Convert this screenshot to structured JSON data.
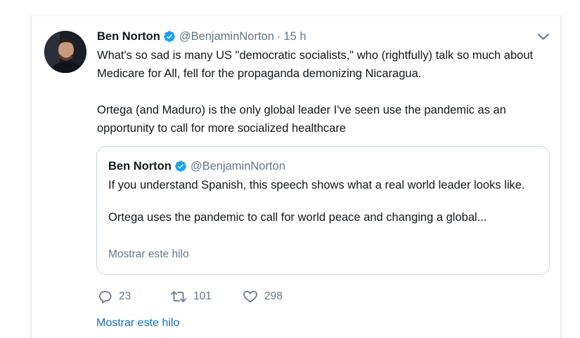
{
  "tweet": {
    "author_name": "Ben Norton",
    "handle": "@BenjaminNorton",
    "separator": "·",
    "time": "15 h",
    "paragraph_1": "What's so sad is many US \"democratic socialists,\" who (rightfully) talk so much about Medicare for All, fell for the propaganda demonizing Nicaragua.",
    "paragraph_2": "Ortega (and Maduro) is the only global leader I've seen use the pandemic as an opportunity to call for more socialized healthcare"
  },
  "quoted_tweet": {
    "author_name": "Ben Norton",
    "handle": "@BenjaminNorton",
    "paragraph_1": "If you understand Spanish, this speech shows what a real world leader looks like.",
    "paragraph_2": "Ortega uses the pandemic to call for world peace and changing a global...",
    "show_thread": "Mostrar este hilo"
  },
  "actions": {
    "replies": "23",
    "retweets": "101",
    "likes": "298"
  },
  "show_thread_link": "Mostrar este hilo",
  "icons": {
    "verified": "verified-badge-icon",
    "menu": "chevron-down-icon",
    "reply": "reply-icon",
    "retweet": "retweet-icon",
    "like": "heart-icon"
  },
  "colors": {
    "verified_blue": "#1da1f2",
    "secondary_text": "#657786",
    "link_blue": "#1b6fb5",
    "border": "#ccd6dd"
  }
}
